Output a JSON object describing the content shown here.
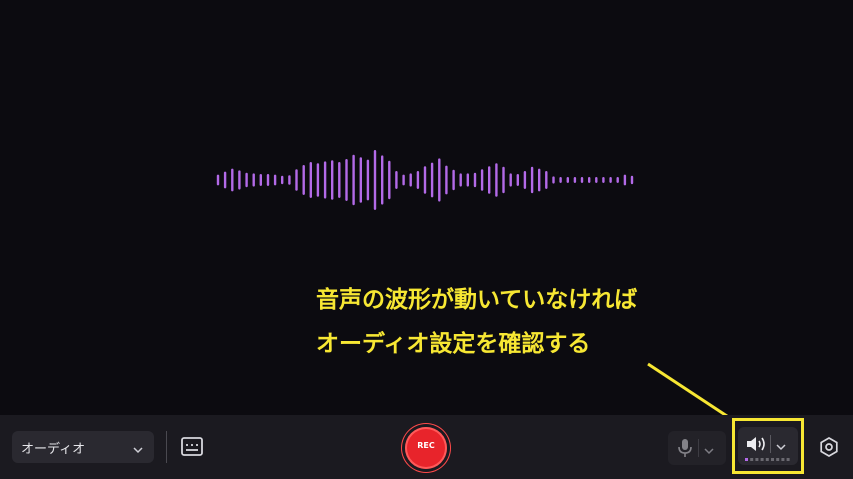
{
  "annotation": {
    "line1": "音声の波形が動いていなければ",
    "line2": "オーディオ設定を確認する",
    "color": "#f7e733"
  },
  "toolbar": {
    "source_label": "オーディオ",
    "rec_label": "REC"
  },
  "icons": {
    "source_chevron": "chevron-down-icon",
    "caption": "caption-icon",
    "mic": "microphone-icon",
    "speaker": "speaker-icon",
    "settings": "settings-icon"
  },
  "colors": {
    "background": "#0c0b10",
    "toolbar": "#1b1a20",
    "waveform": "#b36ae8",
    "rec": "#e8242b",
    "meter_active": "#b36ae8"
  },
  "waveform_levels": [
    0.18,
    0.28,
    0.38,
    0.32,
    0.24,
    0.22,
    0.2,
    0.2,
    0.18,
    0.14,
    0.16,
    0.36,
    0.5,
    0.6,
    0.56,
    0.62,
    0.66,
    0.6,
    0.7,
    0.84,
    0.76,
    0.68,
    1.0,
    0.82,
    0.64,
    0.3,
    0.18,
    0.22,
    0.3,
    0.46,
    0.58,
    0.72,
    0.48,
    0.34,
    0.22,
    0.22,
    0.24,
    0.36,
    0.46,
    0.56,
    0.44,
    0.22,
    0.2,
    0.3,
    0.44,
    0.38,
    0.3,
    0.12,
    0.1,
    0.1,
    0.1,
    0.1,
    0.1,
    0.1,
    0.1,
    0.1,
    0.1,
    0.18,
    0.14
  ],
  "speaker_meter": {
    "segments": 9,
    "active": 1
  }
}
